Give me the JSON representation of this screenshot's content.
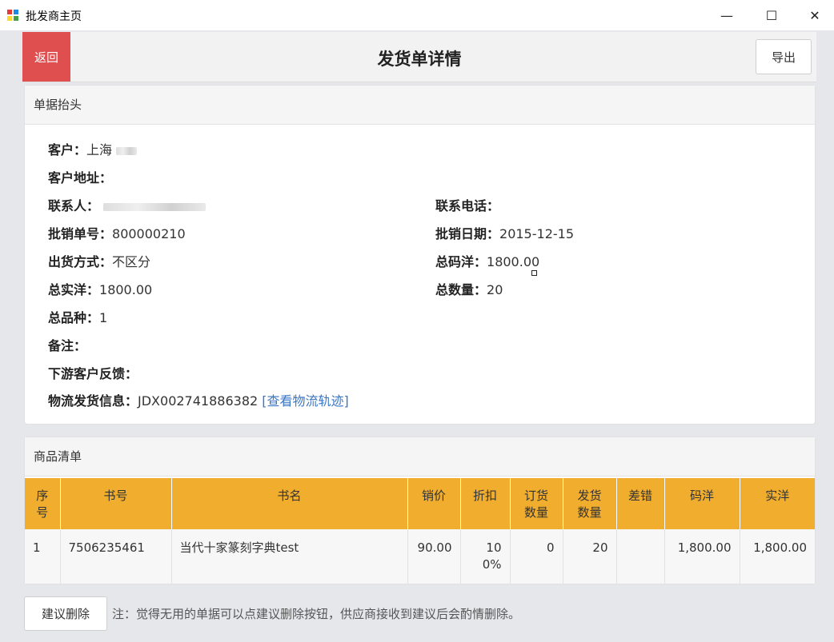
{
  "window": {
    "title": "批发商主页",
    "minimize_glyph": "—",
    "maximize_glyph": "☐",
    "close_glyph": "✕"
  },
  "header": {
    "back_label": "返回",
    "title": "发货单详情",
    "export_label": "导出",
    "back_color": "#df4f4f"
  },
  "doc_header": {
    "section_title": "单据抬头",
    "customer_label": "客户：",
    "customer_value": "上海",
    "address_label": "客户地址：",
    "address_value": "",
    "contact_label": "联系人：",
    "phone_label": "联系电话：",
    "phone_value": "",
    "order_no_label": "批销单号：",
    "order_no_value": "800000210",
    "order_date_label": "批销日期：",
    "order_date_value": "2015-12-15",
    "ship_method_label": "出货方式：",
    "ship_method_value": "不区分",
    "total_list_label": "总码洋：",
    "total_list_value": "1800.00",
    "total_net_label": "总实洋：",
    "total_net_value": "1800.00",
    "total_qty_label": "总数量：",
    "total_qty_value": "20",
    "total_kinds_label": "总品种：",
    "total_kinds_value": "1",
    "remark_label": "备注：",
    "remark_value": "",
    "feedback_label": "下游客户反馈：",
    "feedback_value": "",
    "logistics_label": "物流发货信息：",
    "logistics_value": "JDX002741886382",
    "logistics_link": "[查看物流轨迹]"
  },
  "goods": {
    "section_title": "商品清单",
    "header_color": "#f0ad2e",
    "columns": {
      "seq_1": "序",
      "seq_2": "号",
      "isbn": "书号",
      "name": "书名",
      "price": "销价",
      "discount": "折扣",
      "order_qty_1": "订货",
      "order_qty_2": "数量",
      "ship_qty_1": "发货",
      "ship_qty_2": "数量",
      "diff": "差错",
      "list_amount": "码洋",
      "net_amount": "实洋"
    },
    "rows": [
      {
        "seq": "1",
        "isbn": "7506235461",
        "name": "当代十家篆刻字典test",
        "price": "90.00",
        "discount_1": "10",
        "discount_2": "0%",
        "order_qty": "0",
        "ship_qty": "20",
        "diff": "",
        "list_amount": "1,800.00",
        "net_amount": "1,800.00"
      }
    ]
  },
  "footer": {
    "suggest_delete_label": "建议删除",
    "note": "注：觉得无用的单据可以点建议删除按钮，供应商接收到建议后会酌情删除。"
  }
}
